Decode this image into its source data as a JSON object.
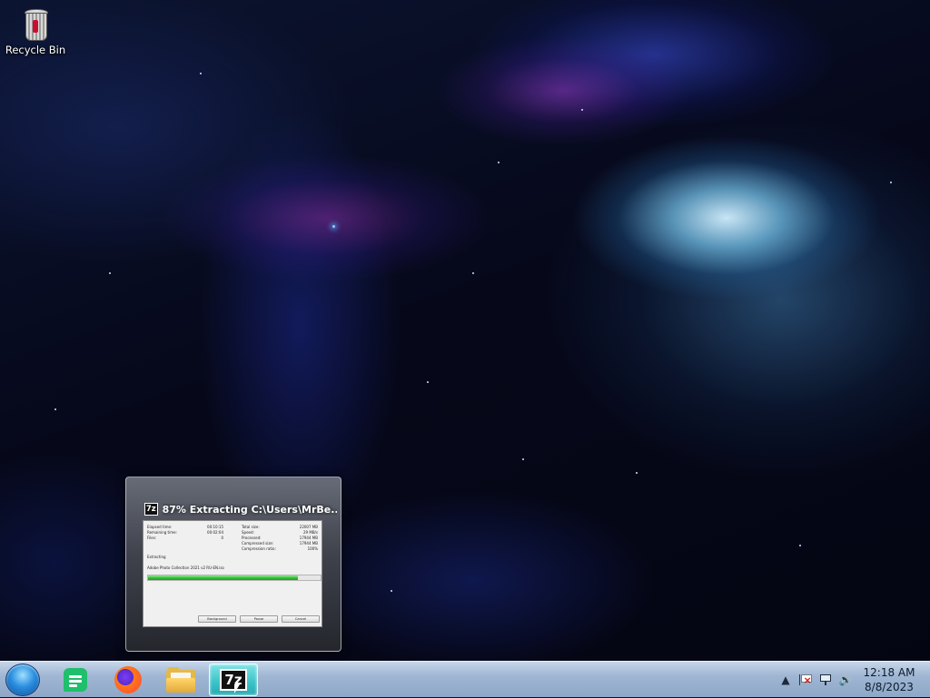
{
  "desktop": {
    "icons": [
      {
        "label": "Recycle Bin",
        "icon": "recycle-bin-icon"
      }
    ]
  },
  "preview": {
    "title": "87% Extracting C:\\Users\\MrBe...",
    "progress_percent": 87,
    "dialog": {
      "left_labels": [
        "Elapsed time:",
        "Remaining time:",
        "Files:"
      ],
      "left_values": [
        "00:10:15",
        "00:02:04",
        "0"
      ],
      "right_labels": [
        "Total size:",
        "Speed:",
        "Processed:",
        "Compressed size:",
        "Compression ratio:"
      ],
      "right_values": [
        "22007 MB",
        "29 MB/s",
        "17944 MB",
        "17944 MB",
        "100%"
      ],
      "status": "Extracting",
      "current_file": "Adobe Photo Collection 2021 v2 RU-EN.iso",
      "buttons": [
        "Background",
        "Pause",
        "Cancel"
      ]
    }
  },
  "taskbar": {
    "apps": [
      {
        "name": "Google Sheets",
        "icon": "sheets-icon"
      },
      {
        "name": "Firefox",
        "icon": "firefox-icon"
      },
      {
        "name": "File Explorer",
        "icon": "folder-icon"
      },
      {
        "name": "7-Zip",
        "icon": "sevenzip-icon",
        "label": "7z"
      }
    ],
    "tray": {
      "time": "12:18 AM",
      "date": "8/8/2023"
    }
  },
  "colors": {
    "progress": "#37c23a",
    "taskbar": "#9fb6d3",
    "active_button": "#39c2c8"
  }
}
